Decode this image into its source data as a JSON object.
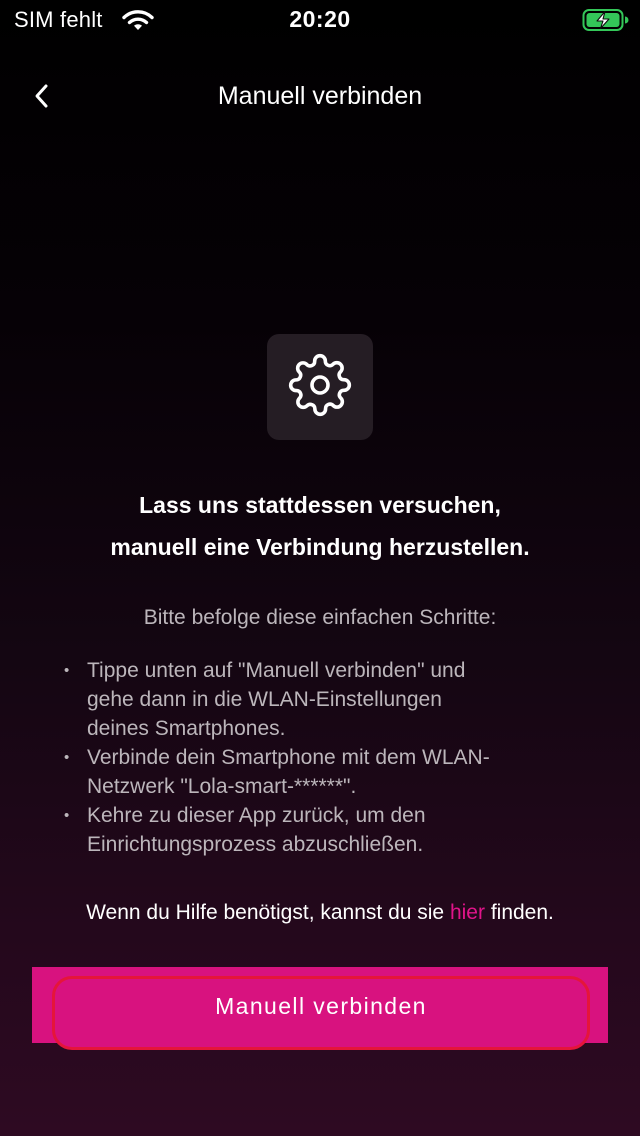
{
  "status_bar": {
    "carrier": "SIM fehlt",
    "time": "20:20",
    "wifi_icon": "wifi-icon",
    "battery_icon": "battery-charging-icon",
    "battery_color": "#34c759"
  },
  "nav": {
    "back_icon": "chevron-left-icon",
    "title": "Manuell verbinden"
  },
  "hero": {
    "icon": "gear-icon"
  },
  "headline": {
    "line1": "Lass uns stattdessen versuchen,",
    "line2": "manuell eine Verbindung herzustellen."
  },
  "instructions": {
    "intro": "Bitte befolge diese einfachen Schritte:",
    "steps": [
      {
        "line1": "Tippe unten auf \"Manuell verbinden\" und",
        "line2": "gehe dann in die WLAN-Einstellungen",
        "line3": "deines Smartphones."
      },
      {
        "line1": "Verbinde dein Smartphone mit dem WLAN-",
        "line2": "Netzwerk \"Lola-smart-******\"."
      },
      {
        "line1": "Kehre zu dieser App zurück, um den",
        "line2": "Einrichtungsprozess abzuschließen."
      }
    ]
  },
  "help": {
    "prefix": "Wenn du Hilfe benötigst, kannst du sie ",
    "link": "hier",
    "suffix": " finden."
  },
  "primary_button": {
    "label": "Manuell verbinden"
  },
  "colors": {
    "accent": "#d8127f",
    "link": "#e0148a",
    "button_outline": "#e5153a",
    "tile": "#251d24",
    "muted_text": "#bcb6bb"
  }
}
